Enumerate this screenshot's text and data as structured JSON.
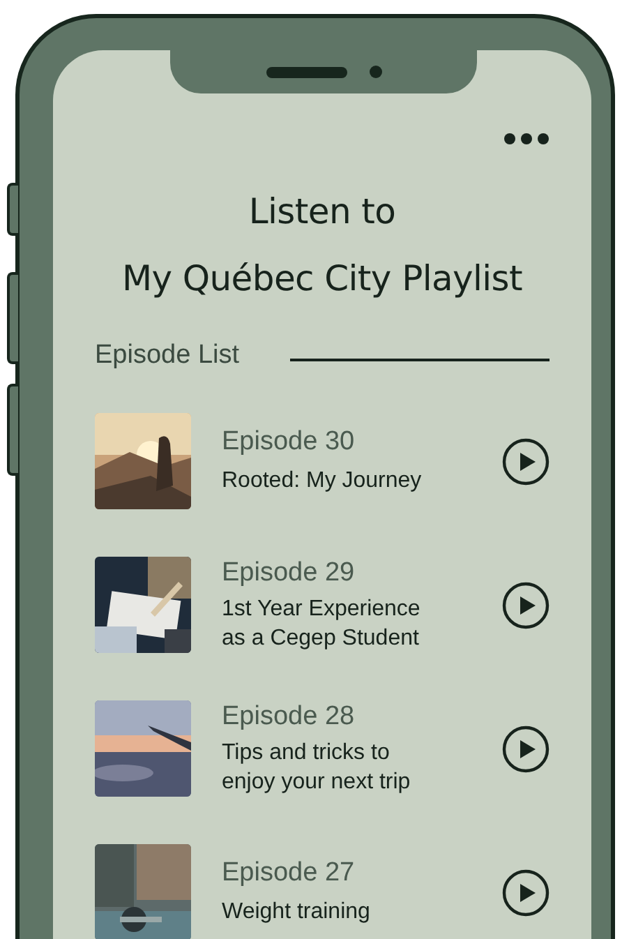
{
  "title_lines": [
    "Listen to",
    "My Québec City Playlist"
  ],
  "section_label": "Episode List",
  "episodes": [
    {
      "number": "Episode 30",
      "title_lines": [
        "Rooted: My Journey"
      ]
    },
    {
      "number": "Episode 29",
      "title_lines": [
        "1st Year Experience",
        "as a Cegep Student"
      ]
    },
    {
      "number": "Episode 28",
      "title_lines": [
        "Tips and tricks to",
        "enjoy your next trip"
      ]
    },
    {
      "number": "Episode 27",
      "title_lines": [
        "Weight training"
      ]
    }
  ]
}
